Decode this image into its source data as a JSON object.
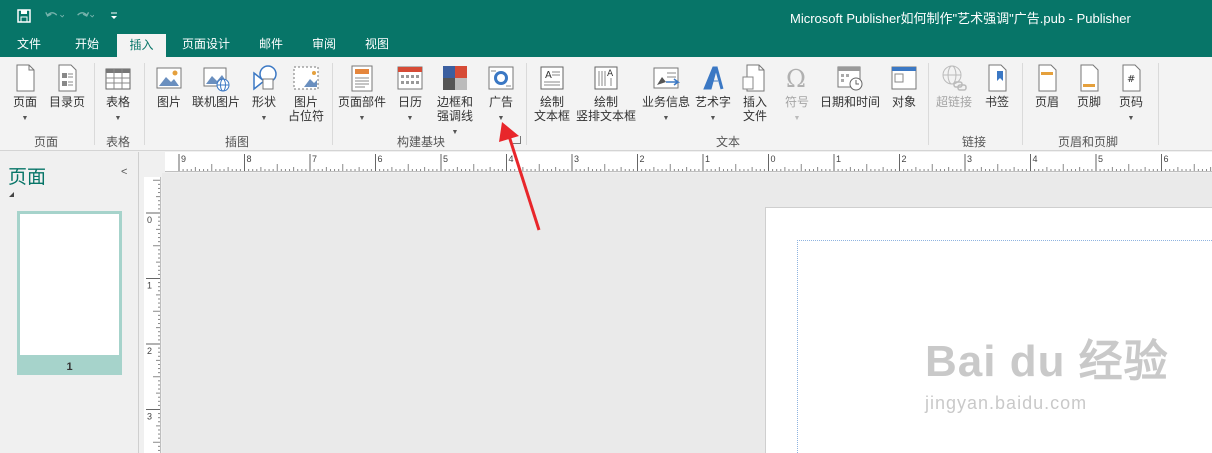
{
  "window": {
    "title": "Microsoft Publisher如何制作\"艺术强调\"广告.pub - Publisher"
  },
  "qat": {
    "save_icon": "save-icon",
    "undo_icon": "undo-icon",
    "redo_icon": "redo-icon",
    "customize_icon": "customize-qat-icon"
  },
  "tabs": [
    {
      "label": "文件"
    },
    {
      "label": "开始"
    },
    {
      "label": "插入"
    },
    {
      "label": "页面设计"
    },
    {
      "label": "邮件"
    },
    {
      "label": "审阅"
    },
    {
      "label": "视图"
    }
  ],
  "active_tab": "插入",
  "ribbon": {
    "buttons": [
      {
        "label": "页面",
        "icon": "page-icon"
      },
      {
        "label": "目录页",
        "icon": "catalog-page-icon"
      },
      {
        "label": "表格",
        "icon": "table-icon"
      },
      {
        "label": "图片",
        "icon": "picture-icon"
      },
      {
        "label": "联机图片",
        "icon": "online-picture-icon"
      },
      {
        "label": "形状",
        "icon": "shapes-icon"
      },
      {
        "label": "图片",
        "label2": "占位符",
        "icon": "picture-placeholder-icon"
      },
      {
        "label": "页面部件",
        "icon": "page-parts-icon"
      },
      {
        "label": "日历",
        "icon": "calendar-icon"
      },
      {
        "label": "边框和",
        "label2": "强调线",
        "icon": "borders-accents-icon"
      },
      {
        "label": "广告",
        "icon": "advertisement-icon"
      },
      {
        "label": "绘制",
        "label2": "文本框",
        "icon": "draw-textbox-icon"
      },
      {
        "label": "绘制",
        "label2": "竖排文本框",
        "icon": "draw-vertical-textbox-icon"
      },
      {
        "label": "业务信息",
        "icon": "business-info-icon"
      },
      {
        "label": "艺术字",
        "icon": "wordart-icon"
      },
      {
        "label": "插入",
        "label2": "文件",
        "icon": "insert-file-icon"
      },
      {
        "label": "符号",
        "icon": "symbol-icon"
      },
      {
        "label": "日期和时间",
        "icon": "date-time-icon"
      },
      {
        "label": "对象",
        "icon": "object-icon"
      },
      {
        "label": "超链接",
        "icon": "hyperlink-icon"
      },
      {
        "label": "书签",
        "icon": "bookmark-icon"
      },
      {
        "label": "页眉",
        "icon": "header-icon"
      },
      {
        "label": "页脚",
        "icon": "footer-icon"
      },
      {
        "label": "页码",
        "icon": "page-number-icon"
      }
    ],
    "groups": [
      "页面",
      "表格",
      "插图",
      "构建基块",
      "文本",
      "链接",
      "页眉和页脚"
    ]
  },
  "pages_pane": {
    "title": "页面",
    "page_number": "1"
  },
  "rulers": {
    "top_labels": [
      "9",
      "8",
      "7",
      "6",
      "5",
      "4",
      "3",
      "2",
      "1",
      "0",
      "1",
      "2",
      "3",
      "4",
      "5",
      "6"
    ],
    "left_labels": [
      "0",
      "1",
      "2",
      "3"
    ]
  },
  "watermark": {
    "logo": "Bai du 经验",
    "url": "jingyan.baidu.com"
  },
  "colors": {
    "brand": "#077568",
    "thumb_frame": "#a6d3cb",
    "annotation_arrow": "#e8262b"
  }
}
